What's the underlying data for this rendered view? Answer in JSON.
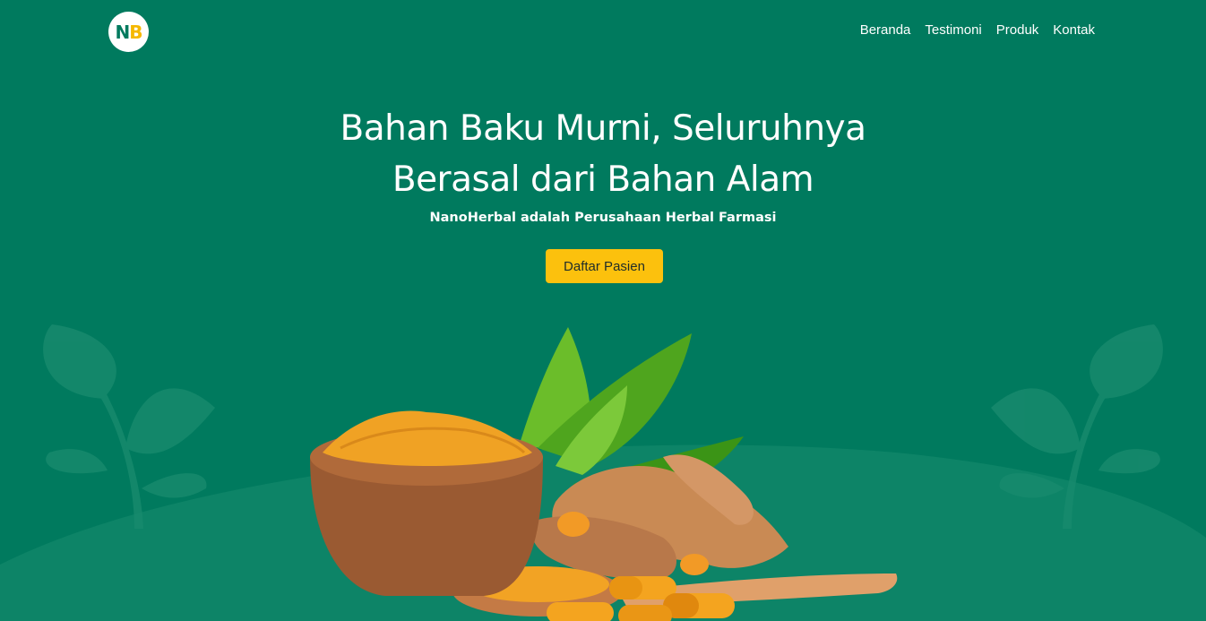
{
  "logo": {
    "letter1": "N",
    "letter2": "B"
  },
  "nav": {
    "items": [
      "Beranda",
      "Testimoni",
      "Produk",
      "Kontak"
    ]
  },
  "hero": {
    "title_line1": "Bahan Baku Murni, Seluruhnya",
    "title_line2": "Berasal dari Bahan Alam",
    "subtitle": "NanoHerbal adalah Perusahaan Herbal Farmasi",
    "cta_label": "Daftar Pasien"
  },
  "colors": {
    "background": "#007a5e",
    "accent": "#fcc10d",
    "logo_n": "#007a5e",
    "logo_b": "#f5b800"
  },
  "images": {
    "left_plant": "plant-silhouette-icon",
    "right_plant": "plant-silhouette-icon",
    "hero_product": "turmeric-bowl-illustration"
  }
}
